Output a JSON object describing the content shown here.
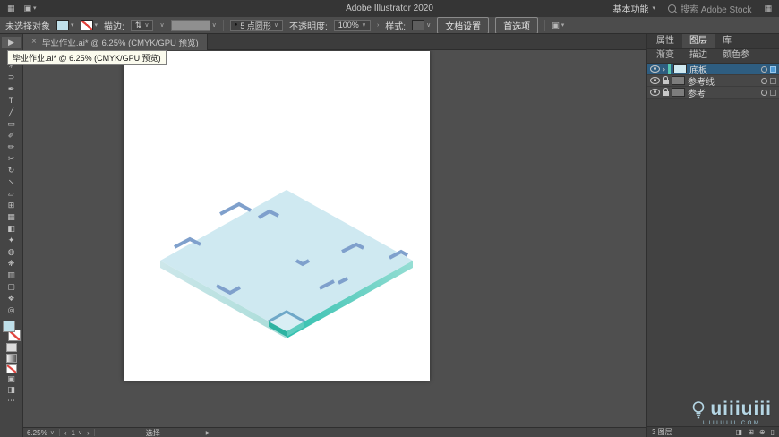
{
  "app": {
    "title": "Adobe Illustrator 2020",
    "workspace": "基本功能",
    "search_placeholder": "搜索 Adobe Stock"
  },
  "icons": {
    "grid": "▦",
    "layout": "▣",
    "dropdown": "∨",
    "small_arrow": "▾",
    "close": "×",
    "bullet": "●",
    "stepper": "⇅",
    "expand": "›",
    "nav_left": "‹",
    "nav_right": "›",
    "play": "▶",
    "ellipsis": "⋯",
    "mask": "◨",
    "new_sublayer": "⊞",
    "new_layer": "⊕",
    "trash": "▯"
  },
  "controlbar": {
    "selection_status": "未选择对象",
    "stroke_label": "描边:",
    "brush_name": "5 点圆形",
    "opacity_label": "不透明度:",
    "opacity_value": "100%",
    "style_label": "样式:",
    "document_setup": "文档设置",
    "preferences": "首选项"
  },
  "document_tab": {
    "title": "毕业作业.ai* @ 6.25% (CMYK/GPU 预览)"
  },
  "tooltip": {
    "text": "毕业作业.ai* @ 6.25% (CMYK/GPU 预览)"
  },
  "tools": [
    {
      "name": "selection",
      "glyph": "▶"
    },
    {
      "name": "direct-selection",
      "glyph": "▷"
    },
    {
      "name": "magic-wand",
      "glyph": "✳"
    },
    {
      "name": "lasso",
      "glyph": "⊃"
    },
    {
      "name": "pen",
      "glyph": "✒"
    },
    {
      "name": "type",
      "glyph": "T"
    },
    {
      "name": "line-segment",
      "glyph": "╱"
    },
    {
      "name": "rectangle",
      "glyph": "▭"
    },
    {
      "name": "paintbrush",
      "glyph": "✐"
    },
    {
      "name": "pencil",
      "glyph": "✏"
    },
    {
      "name": "scissors",
      "glyph": "✂"
    },
    {
      "name": "rotate",
      "glyph": "↻"
    },
    {
      "name": "scale",
      "glyph": "↘"
    },
    {
      "name": "free-transform",
      "glyph": "▱"
    },
    {
      "name": "shape-builder",
      "glyph": "⊞"
    },
    {
      "name": "mesh",
      "glyph": "▦"
    },
    {
      "name": "gradient",
      "glyph": "◧"
    },
    {
      "name": "eyedropper",
      "glyph": "✦"
    },
    {
      "name": "blend",
      "glyph": "◍"
    },
    {
      "name": "symbol-sprayer",
      "glyph": "❋"
    },
    {
      "name": "column-graph",
      "glyph": "▥"
    },
    {
      "name": "artboard",
      "glyph": "▢"
    },
    {
      "name": "hand",
      "glyph": "❖"
    },
    {
      "name": "zoom",
      "glyph": "◎"
    }
  ],
  "panel": {
    "tabs_row1": [
      {
        "label": "属性"
      },
      {
        "label": "图层"
      },
      {
        "label": "库"
      }
    ],
    "tabs_row2": [
      {
        "label": "渐变"
      },
      {
        "label": "描边"
      },
      {
        "label": "颜色参"
      }
    ],
    "layers": [
      {
        "name": "底板"
      },
      {
        "name": "参考线"
      },
      {
        "name": "参考"
      }
    ],
    "footer_count": "3 图层"
  },
  "statusbar": {
    "zoom": "6.25%",
    "artboard_number": "1",
    "tool_status": "选择"
  },
  "watermark": {
    "brand": "uiiiuiii",
    "sub": "UIIIUIII.COM"
  },
  "colors": {
    "selection_highlight": "#2e5d80",
    "fill_swatch": "#bfe0ea",
    "tile_top": "#cfe9f1",
    "tile_edge_teal": "#2fbfae",
    "tile_mark_blue": "#7fa0cc"
  }
}
